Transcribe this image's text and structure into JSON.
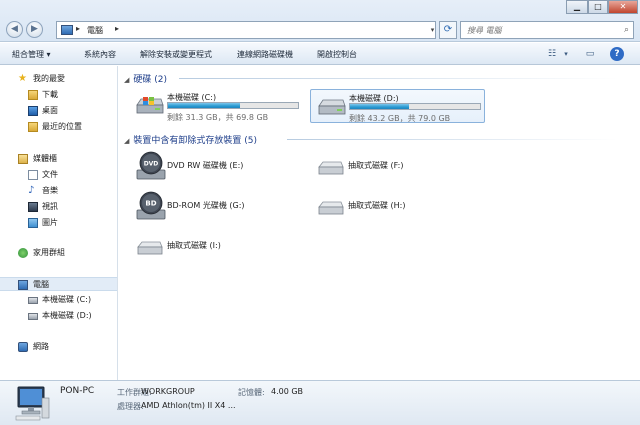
{
  "window": {
    "minimize_label": "▁",
    "maximize_label": "□",
    "close_label": "✕"
  },
  "address": {
    "crumb": "電腦",
    "arrow": "▸"
  },
  "search": {
    "placeholder": "搜尋 電腦"
  },
  "toolbar": {
    "items": [
      "組合管理 ▾",
      "系統內容",
      "解除安裝或變更程式",
      "連線網路磁碟機",
      "開啟控制台"
    ],
    "help_label": "?"
  },
  "sidebar": {
    "favorites": {
      "label": "我的最愛",
      "items": [
        "下載",
        "桌面",
        "最近的位置"
      ]
    },
    "libraries": {
      "label": "媒體櫃",
      "items": [
        "文件",
        "音樂",
        "視訊",
        "圖片"
      ]
    },
    "homegroup": "家用群組",
    "computer": {
      "label": "電腦",
      "items": [
        "本機磁碟 (C:)",
        "本機磁碟 (D:)"
      ]
    },
    "network": "網路"
  },
  "groups": {
    "hdd": "硬碟 (2)",
    "removable": "裝置中含有卸除式存放裝置 (5)"
  },
  "drives": [
    {
      "name": "本機磁碟 (C:)",
      "info": "剩餘 31.3 GB，共 69.8 GB",
      "used_fraction": 0.55
    },
    {
      "name": "本機磁碟 (D:)",
      "info": "剩餘 43.2 GB，共 79.0 GB",
      "used_fraction": 0.45
    }
  ],
  "devices": [
    {
      "name": "DVD RW 磁碟機 (E:)",
      "icon": "dvd-drive-icon",
      "badge": "DVD"
    },
    {
      "name": "抽取式磁碟 (F:)",
      "icon": "removable-disk-icon"
    },
    {
      "name": "BD-ROM 光碟機 (G:)",
      "icon": "bd-drive-icon",
      "badge": "BD"
    },
    {
      "name": "抽取式磁碟 (H:)",
      "icon": "removable-disk-icon"
    },
    {
      "name": "抽取式磁碟 (I:)",
      "icon": "removable-disk-icon"
    }
  ],
  "details": {
    "computer_name": "PON-PC",
    "workgroup_label": "工作群組:",
    "workgroup_value": "WORKGROUP",
    "memory_label": "記憶體:",
    "memory_value": "4.00 GB",
    "processor_label": "處理器:",
    "processor_value": "AMD Athlon(tm) II X4 ..."
  },
  "colors": {
    "accent": "#1e3e8a",
    "bar_fill": "#2a9ad2",
    "selected_bg": "#e2ecf7"
  }
}
